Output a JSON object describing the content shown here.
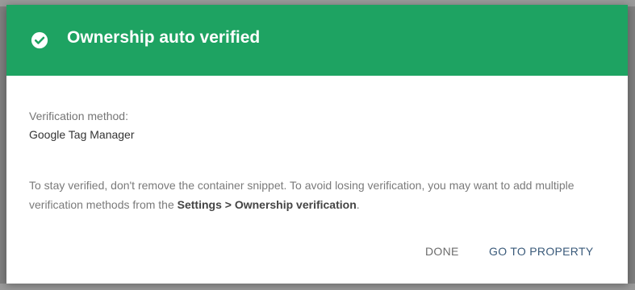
{
  "dialog": {
    "title": "Ownership auto verified",
    "header_color": "#1ea362",
    "header_icon": "check-circle-icon",
    "method_label": "Verification method:",
    "method_value": "Google Tag Manager",
    "info_part1": "To stay verified, don't remove the container snippet. To avoid losing verification, you may want to add multiple verification methods from the ",
    "info_bold": "Settings > Ownership verification",
    "info_part2": ".",
    "done_label": "DONE",
    "go_label": "GO TO PROPERTY"
  }
}
